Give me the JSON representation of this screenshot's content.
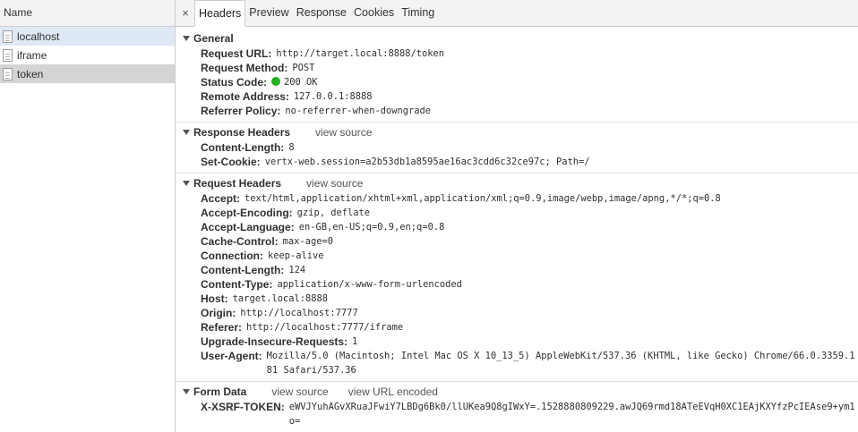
{
  "left": {
    "header": "Name",
    "requests": [
      {
        "name": "localhost"
      },
      {
        "name": "iframe"
      },
      {
        "name": "token"
      }
    ]
  },
  "tabs": {
    "close": "×",
    "items": [
      "Headers",
      "Preview",
      "Response",
      "Cookies",
      "Timing"
    ]
  },
  "general": {
    "title": "General",
    "rows": [
      {
        "key": "Request URL:",
        "value": "http://target.local:8888/token"
      },
      {
        "key": "Request Method:",
        "value": "POST"
      },
      {
        "key": "Status Code:",
        "value": "200 OK"
      },
      {
        "key": "Remote Address:",
        "value": "127.0.0.1:8888"
      },
      {
        "key": "Referrer Policy:",
        "value": "no-referrer-when-downgrade"
      }
    ]
  },
  "response_headers": {
    "title": "Response Headers",
    "view_source": "view source",
    "rows": [
      {
        "key": "Content-Length:",
        "value": "8"
      },
      {
        "key": "Set-Cookie:",
        "value": "vertx-web.session=a2b53db1a8595ae16ac3cdd6c32ce97c; Path=/"
      }
    ]
  },
  "request_headers": {
    "title": "Request Headers",
    "view_source": "view source",
    "rows": [
      {
        "key": "Accept:",
        "value": "text/html,application/xhtml+xml,application/xml;q=0.9,image/webp,image/apng,*/*;q=0.8"
      },
      {
        "key": "Accept-Encoding:",
        "value": "gzip, deflate"
      },
      {
        "key": "Accept-Language:",
        "value": "en-GB,en-US;q=0.9,en;q=0.8"
      },
      {
        "key": "Cache-Control:",
        "value": "max-age=0"
      },
      {
        "key": "Connection:",
        "value": "keep-alive"
      },
      {
        "key": "Content-Length:",
        "value": "124"
      },
      {
        "key": "Content-Type:",
        "value": "application/x-www-form-urlencoded"
      },
      {
        "key": "Host:",
        "value": "target.local:8888"
      },
      {
        "key": "Origin:",
        "value": "http://localhost:7777"
      },
      {
        "key": "Referer:",
        "value": "http://localhost:7777/iframe"
      },
      {
        "key": "Upgrade-Insecure-Requests:",
        "value": "1"
      },
      {
        "key": "User-Agent:",
        "value": "Mozilla/5.0 (Macintosh; Intel Mac OS X 10_13_5) AppleWebKit/537.36 (KHTML, like Gecko) Chrome/66.0.3359.181 Safari/537.36"
      }
    ]
  },
  "form_data": {
    "title": "Form Data",
    "view_source": "view source",
    "view_url_encoded": "view URL encoded",
    "rows": [
      {
        "key": "X-XSRF-TOKEN:",
        "value": "eWVJYuhAGvXRuaJFwiY7LBDg6Bk0/llUKea9Q8gIWxY=.1528880809229.awJQ69rmd18ATeEVqH0XC1EAjKXYfzPcIEAse9+ym1o="
      }
    ]
  },
  "colors": {
    "status_ok": "#21b221",
    "selected_light": "#dfe9f5",
    "selected_dark": "#d4d4d4"
  }
}
